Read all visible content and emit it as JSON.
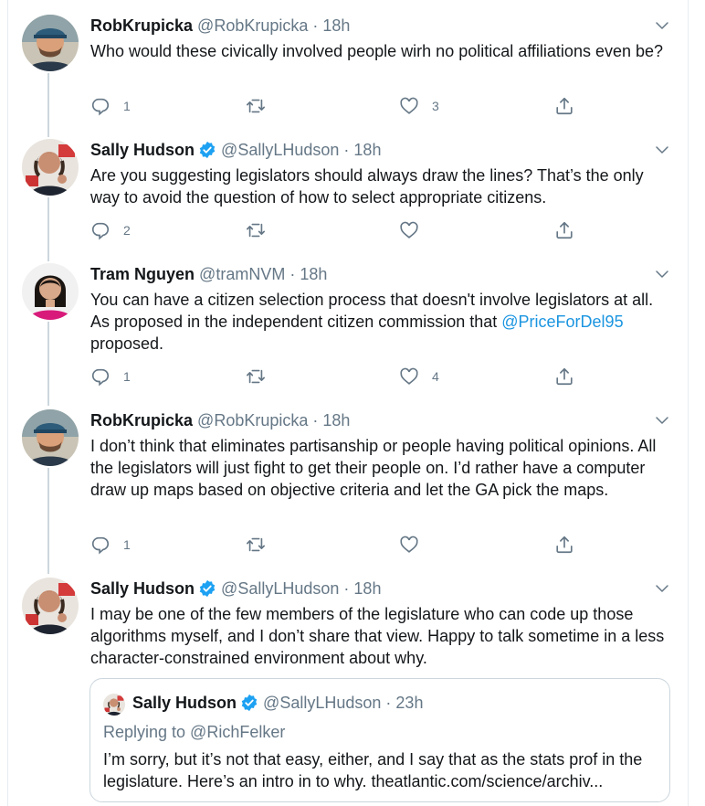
{
  "accent": "#1da1f2",
  "tweets": [
    {
      "name": "RobKrupicka",
      "handle": "@RobKrupicka",
      "sep": "·",
      "time": "18h",
      "verified": false,
      "text": "Who would these civically involved people wirh no political affiliations even be?",
      "replies": "1",
      "retweets": "",
      "likes": "3"
    },
    {
      "name": "Sally Hudson",
      "handle": "@SallyLHudson",
      "sep": "·",
      "time": "18h",
      "verified": true,
      "text": "Are you suggesting legislators should always draw the lines? That’s the only way to avoid the question of how to select appropriate citizens.",
      "replies": "2",
      "retweets": "",
      "likes": ""
    },
    {
      "name": "Tram Nguyen",
      "handle": "@tramNVM",
      "sep": "·",
      "time": "18h",
      "verified": false,
      "text_before": "You can have a citizen selection process that doesn't involve legislators at all. As proposed in the independent citizen commission that ",
      "mention": "@PriceForDel95",
      "text_after": " proposed.",
      "replies": "1",
      "retweets": "",
      "likes": "4"
    },
    {
      "name": "RobKrupicka",
      "handle": "@RobKrupicka",
      "sep": "·",
      "time": "18h",
      "verified": false,
      "text": "I don’t think that eliminates partisanship or people having political opinions. All the legislators will just fight to get their people on. I’d rather have a computer draw up maps based on objective criteria and let the GA pick the maps.",
      "replies": "1",
      "retweets": "",
      "likes": ""
    },
    {
      "name": "Sally Hudson",
      "handle": "@SallyLHudson",
      "sep": "·",
      "time": "18h",
      "verified": true,
      "text": "I may be one of the few members of the legislature who can code up those algorithms myself, and I don’t share that view. Happy to talk sometime in a less character-constrained environment about why."
    }
  ],
  "quote": {
    "name": "Sally Hudson",
    "handle": "@SallyLHudson",
    "sep": "·",
    "time": "23h",
    "replying": "Replying to @RichFelker",
    "text": "I’m sorry, but it’s not that easy, either, and I say that as the stats prof in the legislature. Here’s an intro in to why. theatlantic.com/science/archiv..."
  }
}
